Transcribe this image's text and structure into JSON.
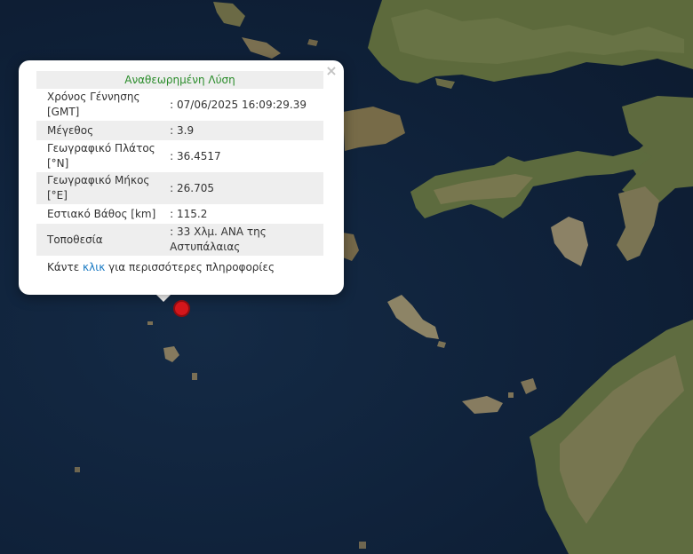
{
  "map": {
    "colors": {
      "sea": "#122741",
      "land": "#5a6a3d",
      "land_light": "#8a7d5a",
      "marker": "#d4161b"
    },
    "marker_icon": "earthquake-epicenter-marker"
  },
  "popup": {
    "close_label": "×",
    "header": "Αναθεωρημένη Λύση",
    "rows": [
      {
        "label": "Χρόνος Γέννησης [GMT]",
        "value": ": 07/06/2025 16:09:29.39"
      },
      {
        "label": "Μέγεθος",
        "value": ": 3.9"
      },
      {
        "label": "Γεωγραφικό Πλάτος [°N]",
        "value": ": 36.4517"
      },
      {
        "label": "Γεωγραφικό Μήκος [°E]",
        "value": ": 26.705"
      },
      {
        "label": "Εστιακό Βάθος [km]",
        "value": ": 115.2"
      },
      {
        "label": "Τοποθεσία",
        "value": ": 33 Χλμ. ΑΝΑ της Αστυπάλαιας"
      }
    ],
    "more_prefix": "Κάντε ",
    "more_link": "κλικ",
    "more_suffix": " για περισσότερες πληροφορίες"
  }
}
